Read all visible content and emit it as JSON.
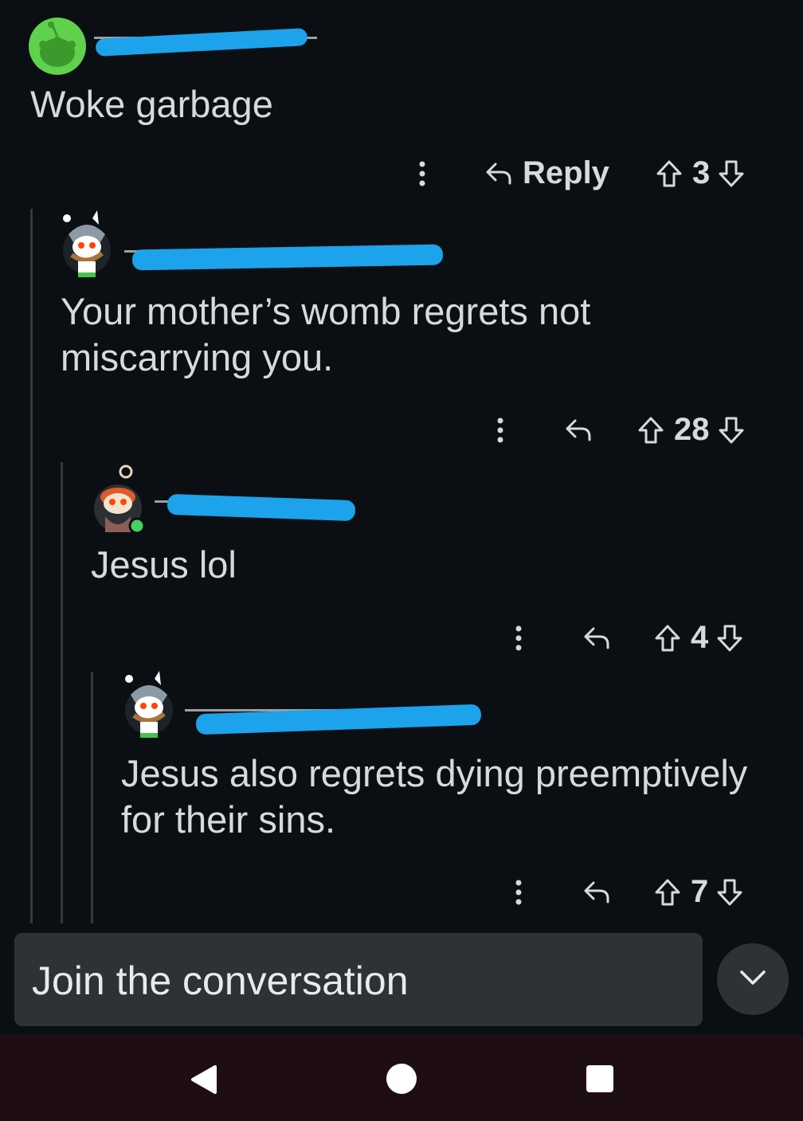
{
  "comments": [
    {
      "body": "Woke garbage",
      "reply_label": "Reply",
      "score": "3"
    },
    {
      "body": "Your mother’s womb regrets not miscarrying you.",
      "score": "28"
    },
    {
      "body": "Jesus lol",
      "score": "4"
    },
    {
      "body": "Jesus also regrets dying preemptively for their sins.",
      "score": "7"
    }
  ],
  "composer": {
    "placeholder": "Join the conversation"
  },
  "colors": {
    "background": "#0b0f13",
    "redaction_scribble": "#1ca3ec",
    "composer_bg": "#2c3235",
    "navbar_bg": "#1f0d15"
  },
  "icons": [
    "snoo-avatar",
    "more-options-icon",
    "reply-arrow-icon",
    "upvote-icon",
    "downvote-icon",
    "chevron-down-icon",
    "back-icon",
    "home-icon",
    "recents-icon"
  ]
}
